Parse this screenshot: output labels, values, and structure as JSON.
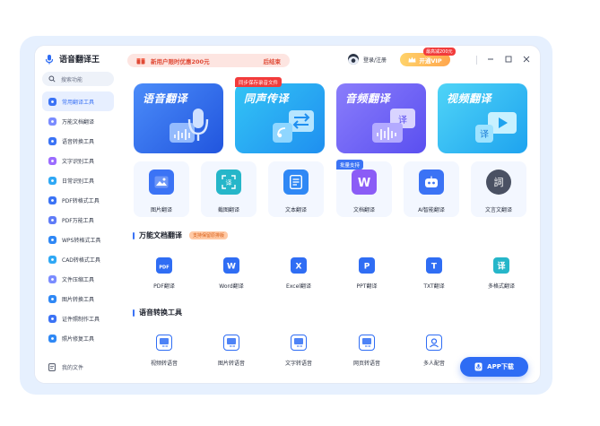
{
  "app": {
    "name": "语音翻译王"
  },
  "search": {
    "placeholder": "搜索功能"
  },
  "sidebar": {
    "items": [
      {
        "label": "常用翻译工具",
        "color": "#3b73f5",
        "active": true
      },
      {
        "label": "万能文档翻译",
        "color": "#7a8cff"
      },
      {
        "label": "语音转换工具",
        "color": "#3b73f5"
      },
      {
        "label": "文字识别工具",
        "color": "#9b6cff"
      },
      {
        "label": "日常识别工具",
        "color": "#2fa8f5"
      },
      {
        "label": "PDF转格式工具",
        "color": "#3b73f5"
      },
      {
        "label": "PDF万能工具",
        "color": "#5f7cf7"
      },
      {
        "label": "WPS转格式工具",
        "color": "#2f88f5"
      },
      {
        "label": "CAD转格式工具",
        "color": "#2fa8f5"
      },
      {
        "label": "文件压缩工具",
        "color": "#7a8cff"
      },
      {
        "label": "图片转换工具",
        "color": "#2f88f5"
      },
      {
        "label": "证件照制作工具",
        "color": "#3b73f5"
      },
      {
        "label": "照片修复工具",
        "color": "#2f88f5"
      }
    ],
    "my_files": "我的文件"
  },
  "header": {
    "promo_text": "新用户限时优惠200元",
    "promo_action": "后结束",
    "login": "登录/注册",
    "vip": "开通VIP",
    "vip_badge": "最高减200元"
  },
  "big_cards": [
    {
      "title": "语音翻译",
      "from": "#4b8cf9",
      "to": "#2155de"
    },
    {
      "title": "同声传译",
      "from": "#33c4f5",
      "to": "#1f8ff0",
      "tag": "同步保存录音文件"
    },
    {
      "title": "音频翻译",
      "from": "#8a7dfb",
      "to": "#5a4ff0"
    },
    {
      "title": "视频翻译",
      "from": "#4fd4f7",
      "to": "#1ea3ef"
    }
  ],
  "tiles": [
    {
      "label": "图片翻译",
      "color": "#3b73f5"
    },
    {
      "label": "截图翻译",
      "color": "#26b6c9"
    },
    {
      "label": "文本翻译",
      "color": "#2f88f5"
    },
    {
      "label": "文档翻译",
      "color": "#8b5cf6",
      "tag": "批量支持"
    },
    {
      "label": "AI智能翻译",
      "color": "#3b73f5"
    },
    {
      "label": "文言文翻译",
      "color": "#4a5163"
    }
  ],
  "sections": {
    "doc": {
      "title": "万能文档翻译",
      "tag": "支持保留原排版"
    },
    "voice": {
      "title": "语音转换工具"
    }
  },
  "doc_items": [
    {
      "label": "PDF翻译",
      "color": "#2f6df4",
      "glyph": "PDF"
    },
    {
      "label": "Word翻译",
      "color": "#2f6df4",
      "glyph": "W"
    },
    {
      "label": "Excel翻译",
      "color": "#2f6df4",
      "glyph": "X"
    },
    {
      "label": "PPT翻译",
      "color": "#2f6df4",
      "glyph": "P"
    },
    {
      "label": "TXT翻译",
      "color": "#2f6df4",
      "glyph": "T"
    },
    {
      "label": "多格式翻译",
      "color": "#26b6c9",
      "glyph": "译"
    }
  ],
  "voice_items": [
    {
      "label": "视频转语音",
      "color": "#2f6df4"
    },
    {
      "label": "图片转语音",
      "color": "#2f6df4"
    },
    {
      "label": "文字转语音",
      "color": "#2f6df4"
    },
    {
      "label": "网页转语音",
      "color": "#2f6df4"
    },
    {
      "label": "多人配音",
      "color": "#2f6df4"
    }
  ],
  "app_download": "APP下载"
}
